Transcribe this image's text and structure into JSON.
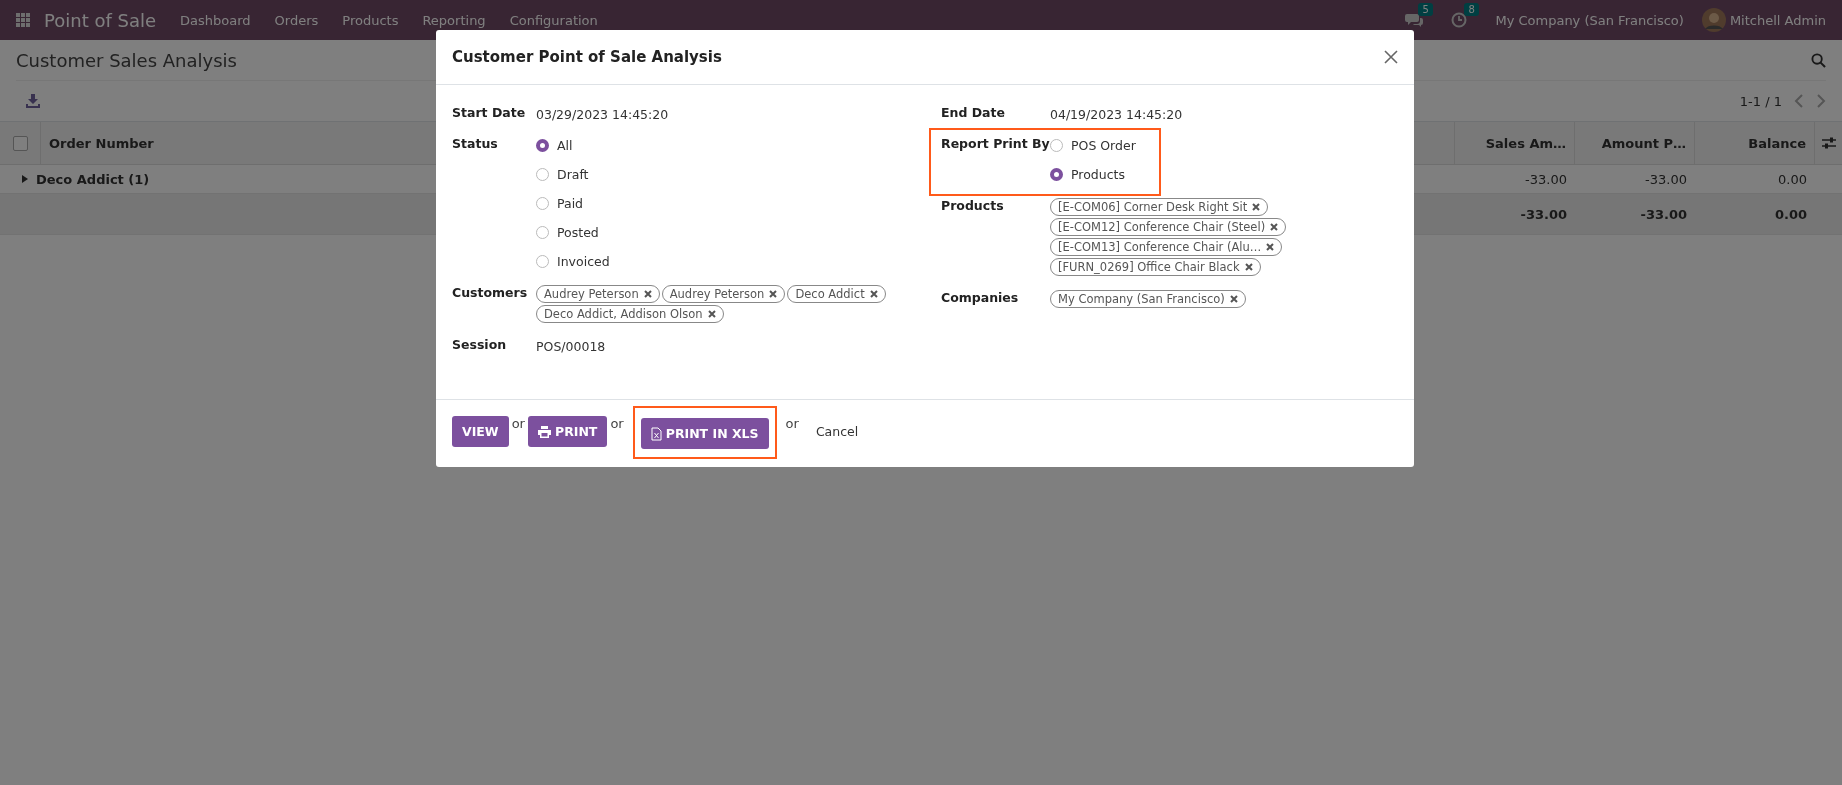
{
  "navbar": {
    "app_name": "Point of Sale",
    "menu": [
      "Dashboard",
      "Orders",
      "Products",
      "Reporting",
      "Configuration"
    ],
    "messages_count": "5",
    "activities_count": "8",
    "company": "My Company (San Francisco)",
    "user": "Mitchell Admin"
  },
  "page": {
    "title": "Customer Sales Analysis",
    "pager": "1-1 / 1",
    "table": {
      "all_selected": false,
      "columns": [
        {
          "label": "Order Number"
        },
        {
          "label": "Sales Am…"
        },
        {
          "label": "Amount P…"
        },
        {
          "label": "Balance"
        }
      ],
      "rows": [
        {
          "kind": "group",
          "label": "Deco Addict (1)",
          "values": [
            "-33.00",
            "-33.00",
            "0.00"
          ]
        },
        {
          "kind": "total",
          "label": "",
          "values": [
            "-33.00",
            "-33.00",
            "0.00"
          ]
        }
      ]
    }
  },
  "dialog": {
    "title": "Customer Point of Sale Analysis",
    "left_fields": [
      {
        "kind": "text",
        "label": "Start Date",
        "value": "03/29/2023 14:45:20",
        "highlighted": false
      },
      {
        "kind": "radio",
        "label": "Status",
        "highlighted": false,
        "options": [
          {
            "label": "All",
            "selected": true
          },
          {
            "label": "Draft",
            "selected": false
          },
          {
            "label": "Paid",
            "selected": false
          },
          {
            "label": "Posted",
            "selected": false
          },
          {
            "label": "Invoiced",
            "selected": false
          }
        ]
      },
      {
        "kind": "tags",
        "label": "Customers",
        "highlighted": false,
        "tags": [
          "Audrey Peterson",
          "Audrey Peterson",
          "Deco Addict",
          "Deco Addict, Addison Olson"
        ]
      },
      {
        "kind": "text",
        "label": "Session",
        "value": "POS/00018",
        "highlighted": false
      }
    ],
    "right_fields": [
      {
        "kind": "text",
        "label": "End Date",
        "value": "04/19/2023 14:45:20",
        "highlighted": false
      },
      {
        "kind": "radio",
        "label": "Report Print By",
        "highlighted": true,
        "options": [
          {
            "label": "POS Order",
            "selected": false
          },
          {
            "label": "Products",
            "selected": true
          }
        ]
      },
      {
        "kind": "tags",
        "label": "Products",
        "highlighted": false,
        "tags": [
          "[E-COM06] Corner Desk Right Sit",
          "[E-COM12] Conference Chair (Steel)",
          "[E-COM13] Conference Chair (Alu…",
          "[FURN_0269] Office Chair Black"
        ]
      },
      {
        "kind": "tags",
        "label": "Companies",
        "highlighted": false,
        "tags": [
          "My Company (San Francisco)"
        ]
      }
    ],
    "footer": [
      {
        "kind": "view",
        "label": "VIEW",
        "highlighted": false
      },
      {
        "kind": "or",
        "label": "or"
      },
      {
        "kind": "print",
        "label": "PRINT",
        "highlighted": false
      },
      {
        "kind": "or",
        "label": "or"
      },
      {
        "kind": "xls",
        "label": "PRINT IN XLS",
        "highlighted": true
      },
      {
        "kind": "or",
        "label": "or"
      },
      {
        "kind": "cancel",
        "label": "Cancel"
      }
    ]
  }
}
